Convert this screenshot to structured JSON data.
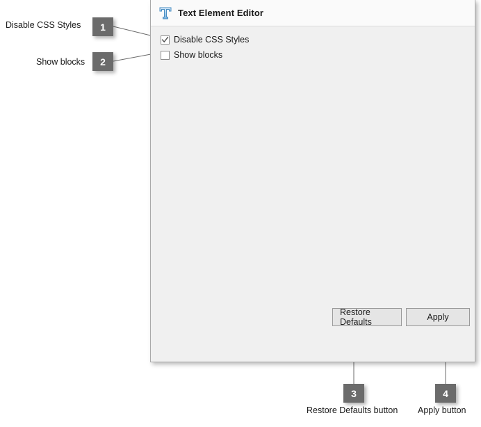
{
  "dialog": {
    "title": "Text Element Editor",
    "icon": "text-t-icon",
    "options": [
      {
        "label": "Disable CSS Styles",
        "checked": true
      },
      {
        "label": "Show blocks",
        "checked": false
      }
    ],
    "buttons": {
      "restore_defaults": "Restore Defaults",
      "apply": "Apply"
    }
  },
  "annotations": [
    {
      "number": "1",
      "label": "Disable CSS Styles"
    },
    {
      "number": "2",
      "label": "Show blocks"
    },
    {
      "number": "3",
      "label": "Restore Defaults button"
    },
    {
      "number": "4",
      "label": "Apply button"
    }
  ],
  "colors": {
    "badge_background": "#6b6b6b",
    "badge_text": "#ffffff",
    "panel_background": "#f0f0f0",
    "header_background": "#fafafa",
    "icon_blue": "#5a9bd5",
    "leader_line": "#6b6b6b"
  }
}
